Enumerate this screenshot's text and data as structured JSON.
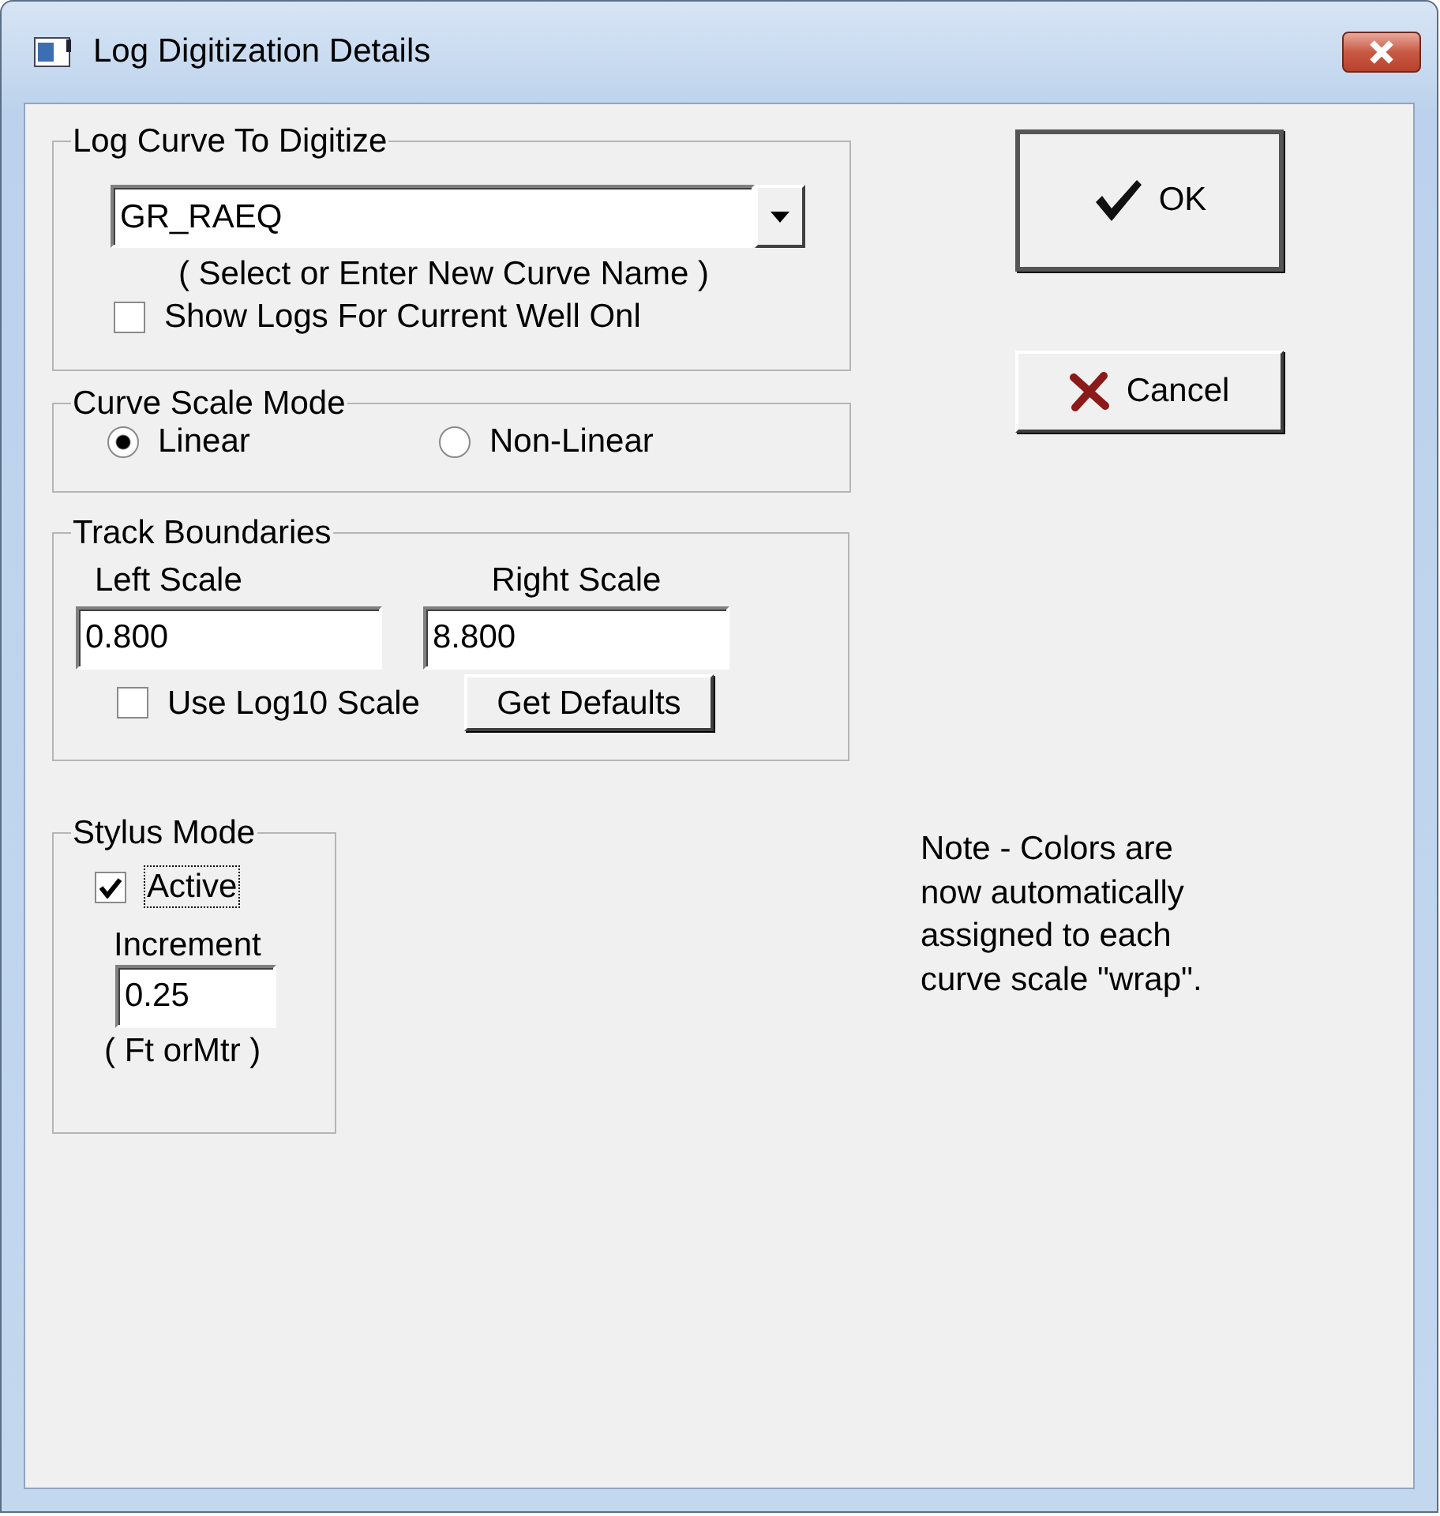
{
  "window": {
    "title": "Log Digitization Details"
  },
  "curve_group": {
    "title": "Log Curve To Digitize",
    "curve": {
      "value": "GR_RAEQ"
    },
    "hint": "( Select or Enter New Curve Name )",
    "show_current_well_only": {
      "label": "Show Logs For Current Well Onl",
      "checked": false
    }
  },
  "scale_mode": {
    "title": "Curve Scale Mode",
    "options": [
      {
        "label": "Linear",
        "selected": true
      },
      {
        "label": "Non-Linear",
        "selected": false
      }
    ]
  },
  "track_boundaries": {
    "title": "Track Boundaries",
    "left_label": "Left Scale",
    "left_value": "0.800",
    "right_label": "Right Scale",
    "right_value": "8.800",
    "use_log10": {
      "label": "Use Log10 Scale",
      "checked": false
    },
    "defaults_button": "Get Defaults"
  },
  "stylus": {
    "title": "Stylus Mode",
    "active": {
      "label": "Active",
      "checked": true
    },
    "increment_label": "Increment",
    "increment_value": "0.25",
    "unit": "( Ft orMtr )"
  },
  "buttons": [
    {
      "label": "OK",
      "kind": "ok"
    },
    {
      "label": "Cancel",
      "kind": "cancel"
    }
  ],
  "note": "Note - Colors are now automatically assigned to each curve scale \"wrap\"."
}
